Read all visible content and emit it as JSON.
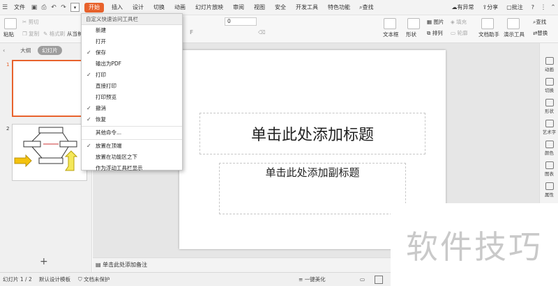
{
  "menubar": {
    "file_label": "文件",
    "tabs": [
      "开始",
      "插入",
      "设计",
      "切换",
      "动画",
      "幻灯片放映",
      "审阅",
      "视图",
      "安全",
      "开发工具",
      "特色功能"
    ],
    "search_label": "查找",
    "anomaly_label": "有异常",
    "share_label": "分享",
    "comment_label": "批注",
    "help_label": "?"
  },
  "ribbon": {
    "paste": "粘贴",
    "cut": "剪切",
    "copy": "复制",
    "format_painter": "格式刷",
    "from_current": "从当前",
    "font_size": "0",
    "textbox": "文本框",
    "shape": "形状",
    "arrange": "排列",
    "outline": "轮廓",
    "fill": "填充",
    "picture": "图片",
    "doc_helper": "文档助手",
    "presentation_tool": "演示工具",
    "find": "查找",
    "replace": "替换"
  },
  "leftpane": {
    "tabs": [
      "大纲",
      "幻灯片"
    ],
    "slide_numbers": [
      "1",
      "2"
    ],
    "add_symbol": "+"
  },
  "slide": {
    "title_placeholder": "单击此处添加标题",
    "subtitle_placeholder": "单击此处添加副标题"
  },
  "notes_placeholder": "单击此处添加备注",
  "rightpane": {
    "items": [
      "动画",
      "切换",
      "形状",
      "艺术字",
      "颜色",
      "图表",
      "属性"
    ]
  },
  "statusbar": {
    "slide_count": "幻灯片 1 / 2",
    "default_template": "默认设计模板",
    "doc_protect": "文档未保护",
    "beautify": "一键美化"
  },
  "quick_access_menu": {
    "title": "自定义快速访问工具栏",
    "items": [
      {
        "label": "新建",
        "checked": false
      },
      {
        "label": "打开",
        "checked": false
      },
      {
        "label": "保存",
        "checked": true
      },
      {
        "label": "输出为PDF",
        "checked": false
      },
      {
        "label": "打印",
        "checked": true
      },
      {
        "label": "直接打印",
        "checked": false
      },
      {
        "label": "打印预览",
        "checked": false
      },
      {
        "label": "撤消",
        "checked": true
      },
      {
        "label": "恢复",
        "checked": true
      },
      {
        "label": "其他命令...",
        "checked": false
      },
      {
        "label": "放置在顶端",
        "checked": true
      },
      {
        "label": "放置在功能区之下",
        "checked": false
      },
      {
        "label": "作为浮动工具栏显示",
        "checked": false
      }
    ],
    "check_mark": "✓"
  },
  "watermark": "软件技巧",
  "colors": {
    "accent": "#e8622c",
    "menu_bg": "#f3f3f3"
  }
}
